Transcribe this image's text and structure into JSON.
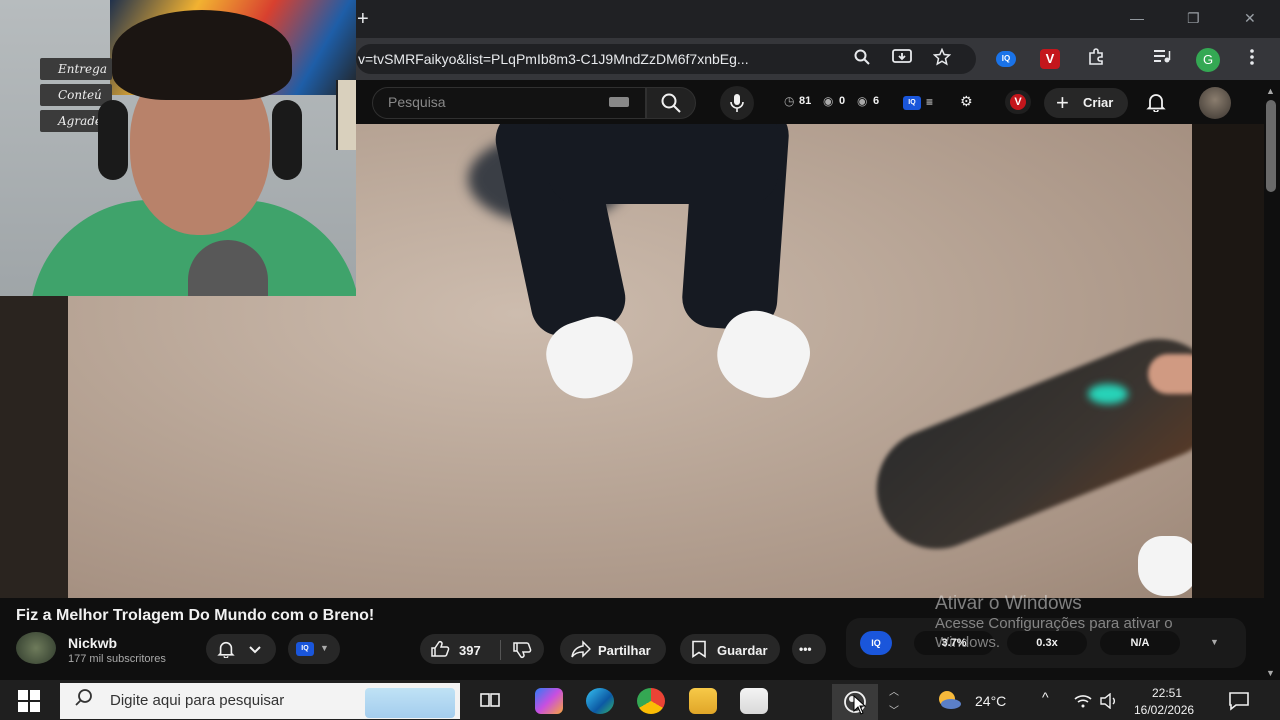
{
  "browser": {
    "new_tab_symbol": "+",
    "url": "v=tvSMRFaikyo&list=PLqPmIb8m3-C1J9MndZzDM6f7xnbEg...",
    "window_minimize": "—",
    "window_restore": "❐",
    "window_close": "✕",
    "extensions": {
      "iq": "IQ",
      "v": "V",
      "profile": "G"
    }
  },
  "youtube": {
    "search_placeholder": "Pesquisa",
    "stats": {
      "views": "81",
      "watching": "0",
      "other": "6"
    },
    "v_badge": "V",
    "create_label": "Criar",
    "video_title": "Fiz a Melhor Trolagem Do Mundo com o Breno!",
    "channel": {
      "name": "Nickwb",
      "subscribers": "177 mil subscritores"
    },
    "iq_chip": "IQ",
    "likes": "397",
    "share_label": "Partilhar",
    "save_label": "Guardar",
    "more_label": "•••",
    "iq_panel": {
      "badge": "IQ",
      "metric_1": "3.7%",
      "metric_2": "0.3x",
      "metric_3": "N/A"
    }
  },
  "webcam": {
    "sign_1": "Entrega",
    "sign_2": "Conteú",
    "sign_3": "Agradeç"
  },
  "windows_watermark": {
    "line_1": "Ativar o Windows",
    "line_2": "Acesse Configurações para ativar o",
    "line_3": "Windows."
  },
  "taskbar": {
    "search_placeholder": "Digite aqui para pesquisar",
    "temperature": "24°C",
    "time": "22:51",
    "date": "16/02/2026"
  },
  "colors": {
    "yt_bg": "#0f0f0f",
    "chip": "#272727",
    "iq_blue": "#1a56db",
    "v_red": "#c4161c"
  }
}
